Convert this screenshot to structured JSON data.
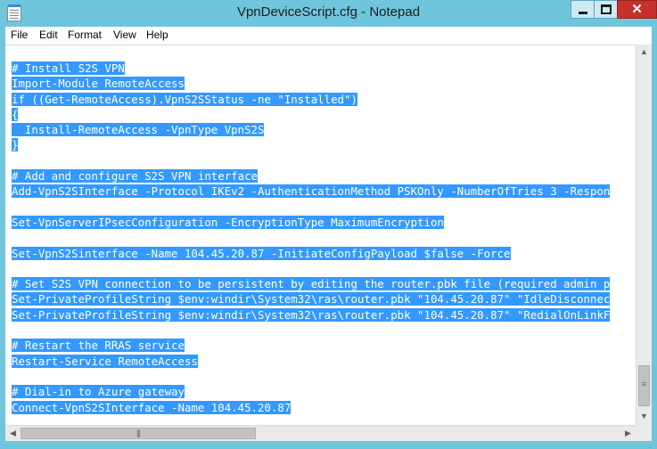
{
  "window": {
    "title": "VpnDeviceScript.cfg - Notepad",
    "controls": {
      "minimize": "minimize",
      "maximize": "maximize",
      "close": "✕"
    }
  },
  "menu": {
    "file": "File",
    "edit": "Edit",
    "format": "Format",
    "view": "View",
    "help": "Help"
  },
  "editor": {
    "lines": [
      "# Install S2S VPN",
      "Import-Module RemoteAccess",
      "if ((Get-RemoteAccess).VpnS2SStatus -ne \"Installed\")",
      "{",
      "  Install-RemoteAccess -VpnType VpnS2S",
      "}",
      "",
      "# Add and configure S2S VPN interface",
      "Add-VpnS2SInterface -Protocol IKEv2 -AuthenticationMethod PSKOnly -NumberOfTries 3 -Respon",
      "",
      "Set-VpnServerIPsecConfiguration -EncryptionType MaximumEncryption",
      "",
      "Set-VpnS2Sinterface -Name 104.45.20.87 -InitiateConfigPayload $false -Force",
      "",
      "# Set S2S VPN connection to be persistent by editing the router.pbk file (required admin p",
      "Set-PrivateProfileString $env:windir\\System32\\ras\\router.pbk \"104.45.20.87\" \"IdleDisconnec",
      "Set-PrivateProfileString $env:windir\\System32\\ras\\router.pbk \"104.45.20.87\" \"RedialOnLinkF",
      "",
      "# Restart the RRAS service",
      "Restart-Service RemoteAccess",
      "",
      "# Dial-in to Azure gateway",
      "Connect-VpnS2SInterface -Name 104.45.20.87"
    ]
  },
  "scrollbars": {
    "vertical": {
      "up": "▲",
      "down": "▼",
      "grip": "≡"
    },
    "horizontal": {
      "left": "◀",
      "right": "▶",
      "grip": "|||"
    }
  },
  "colors": {
    "frame": "#6fc5dc",
    "selection": "#3399ff",
    "close_button": "#c7302b"
  }
}
